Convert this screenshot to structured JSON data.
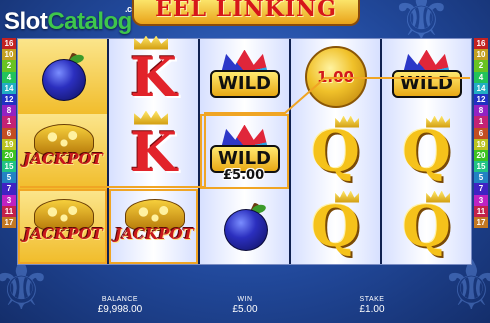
{
  "logo": {
    "part1": "Slot",
    "part2": "Catalog",
    "suffix": ".com"
  },
  "game_title": "EEL LINKING",
  "paylines": {
    "left": [
      "16",
      "10",
      "2",
      "4",
      "14",
      "12",
      "8",
      "1",
      "6",
      "19",
      "20",
      "15",
      "5",
      "7",
      "3",
      "11",
      "17"
    ],
    "right": [
      "16",
      "10",
      "2",
      "4",
      "14",
      "12",
      "8",
      "1",
      "6",
      "19",
      "20",
      "15",
      "5",
      "7",
      "3",
      "11",
      "17"
    ]
  },
  "reels": [
    [
      "plum",
      "jackpot",
      "jackpot"
    ],
    [
      "king",
      "king",
      "jackpot"
    ],
    [
      "wild",
      "wild",
      "plum"
    ],
    [
      "coin",
      "queen",
      "queen"
    ],
    [
      "wild",
      "queen",
      "queen"
    ]
  ],
  "symbols": {
    "wild_text": "WILD",
    "jackpot_text": "JACKPOT",
    "coin_value": "1.00"
  },
  "win_amount": "£5.00",
  "colors": {
    "win_line": "#f0a524",
    "title_text": "#d6171a",
    "background": "#1b3f86"
  },
  "bottom_bar": {
    "balance_label": "BALANCE",
    "balance_value": "£9,998.00",
    "win_label": "WIN",
    "win_value": "£5.00",
    "stake_label": "STAKE",
    "stake_value": "£1.00"
  }
}
